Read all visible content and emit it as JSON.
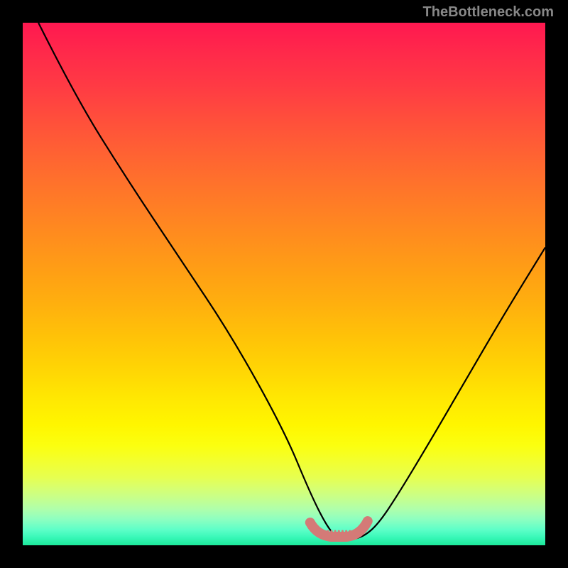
{
  "watermark": "TheBottleneck.com",
  "chart_data": {
    "type": "line",
    "title": "",
    "xlabel": "",
    "ylabel": "",
    "xlim": [
      0,
      100
    ],
    "ylim": [
      0,
      100
    ],
    "minimum_x_range": [
      55,
      66
    ],
    "series": [
      {
        "name": "bottleneck-curve",
        "x": [
          3,
          10,
          20,
          30,
          40,
          50,
          55,
          58,
          60,
          62,
          65,
          68,
          72,
          78,
          85,
          92,
          100
        ],
        "y": [
          100,
          86,
          70,
          55,
          40,
          22,
          10,
          4,
          1.5,
          1,
          1.5,
          4,
          10,
          20,
          32,
          44,
          57
        ]
      }
    ],
    "highlight": {
      "name": "minimum-zone",
      "x_start": 55,
      "x_end": 66,
      "color": "#d47a77"
    },
    "gradient_stops": [
      {
        "pos": 0,
        "color": "#ff1850"
      },
      {
        "pos": 50,
        "color": "#ffb00e"
      },
      {
        "pos": 80,
        "color": "#fff600"
      },
      {
        "pos": 100,
        "color": "#1ce89a"
      }
    ]
  }
}
